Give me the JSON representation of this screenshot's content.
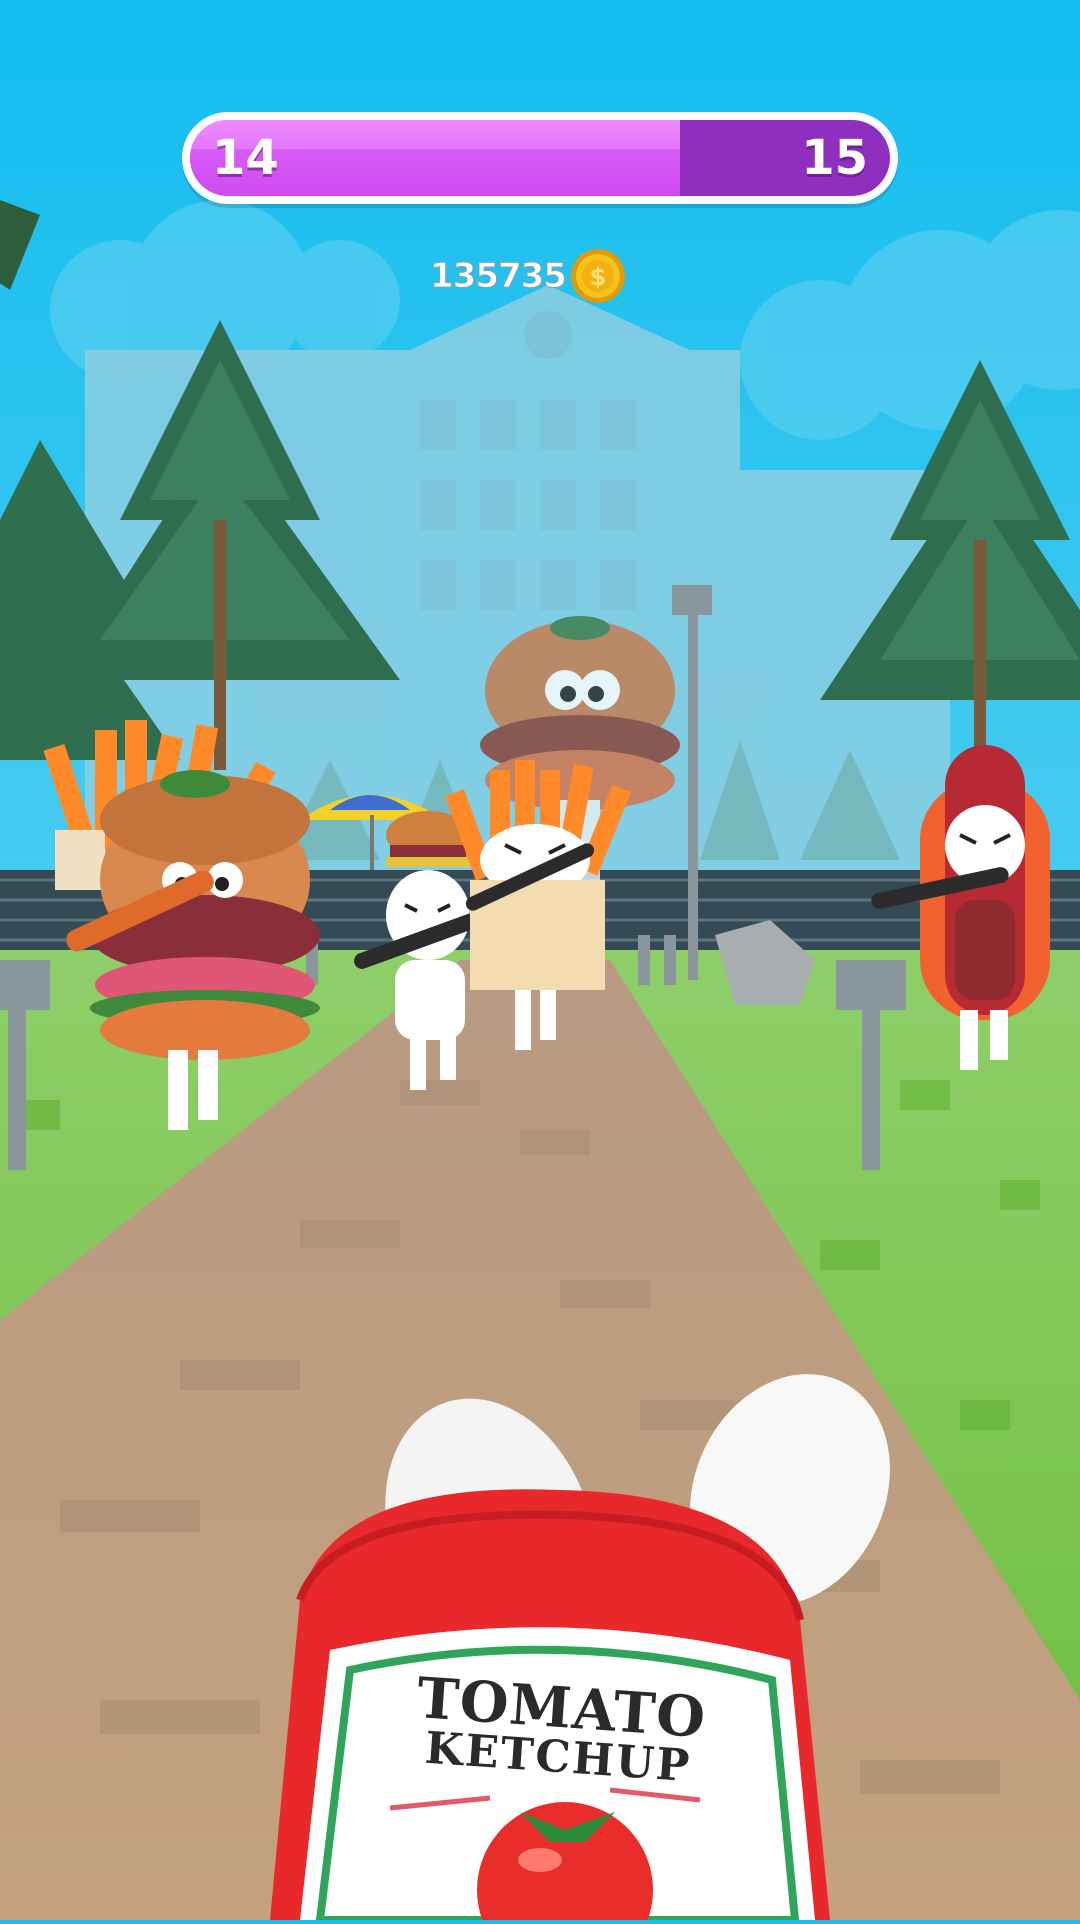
{
  "level": {
    "current": "14",
    "next": "15",
    "progress": 0.7
  },
  "coins": {
    "count": "135735"
  },
  "player": {
    "bottle_line1": "TOMATO",
    "bottle_line2": "KETCHUP"
  },
  "icons": {
    "coin": "coin-dollar-icon"
  },
  "colors": {
    "bar_fill": "#d85bf7",
    "bar_track": "#8e2fc0",
    "coin": "#f5b70f",
    "sky": "#18c1ef",
    "grass": "#74c342"
  }
}
